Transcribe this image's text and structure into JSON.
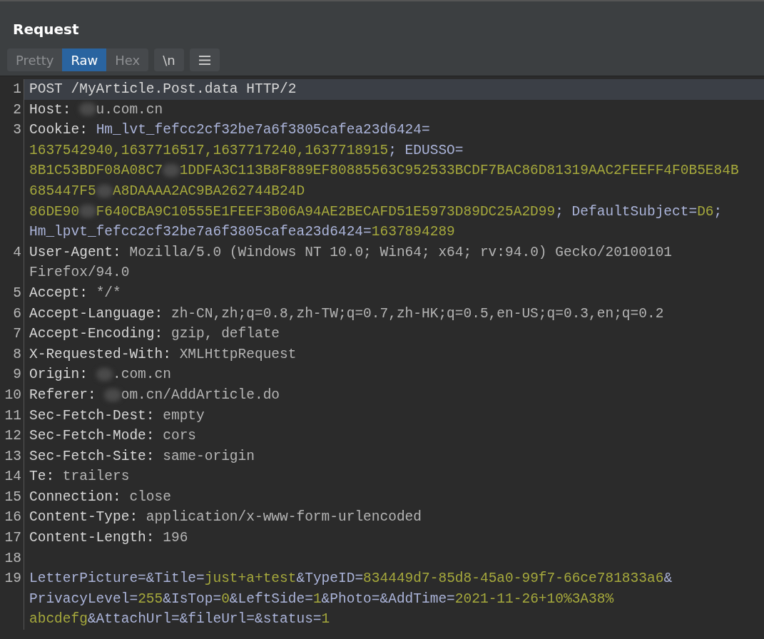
{
  "title": "Request",
  "view_tabs": [
    {
      "label": "Pretty",
      "selected": false
    },
    {
      "label": "Raw",
      "selected": true
    },
    {
      "label": "Hex",
      "selected": false
    }
  ],
  "newline_toggle": {
    "label": "\\n"
  },
  "lines": [
    {
      "number": "1",
      "selected": true,
      "rows": [
        {
          "segments": [
            {
              "kind": "key",
              "text": "POST /MyArticle.Post.data HTTP/2"
            }
          ]
        }
      ]
    },
    {
      "number": "2",
      "selected": false,
      "rows": [
        {
          "segments": [
            {
              "kind": "key",
              "text": "Host: "
            },
            {
              "kind": "redacted"
            },
            {
              "kind": "value",
              "text": "u.com.cn"
            }
          ]
        }
      ]
    },
    {
      "number": "3",
      "selected": false,
      "rows": [
        {
          "segments": [
            {
              "kind": "key",
              "text": "Cookie: "
            },
            {
              "kind": "param",
              "text": "Hm_lvt_fefcc2cf32be7a6f3805cafea23d6424="
            }
          ]
        },
        {
          "segments": [
            {
              "kind": "param_value",
              "text": "1637542940,1637716517,1637717240,1637718915"
            },
            {
              "kind": "param",
              "text": "; EDUSSO="
            }
          ]
        },
        {
          "segments": [
            {
              "kind": "param_value",
              "text": "8B1C53BDF08A08C7"
            },
            {
              "kind": "redacted"
            },
            {
              "kind": "param_value",
              "text": "1DDFA3C113B8F889EF80885563C952533BCDF7BAC86D81319AAC2FEEFF4F0B5E84B"
            }
          ]
        },
        {
          "segments": [
            {
              "kind": "param_value",
              "text": "685447F5"
            },
            {
              "kind": "redacted"
            },
            {
              "kind": "param_value",
              "text": "A8DAAAA2AC9BA262744B24D"
            }
          ]
        },
        {
          "segments": [
            {
              "kind": "param_value",
              "text": "86DE90"
            },
            {
              "kind": "redacted"
            },
            {
              "kind": "param_value",
              "text": "F640CBA9C10555E1FEEF3B06A94AE2BECAFD51E5973D89DC25A2D99"
            },
            {
              "kind": "param",
              "text": "; DefaultSubject="
            },
            {
              "kind": "param_value",
              "text": "D6"
            },
            {
              "kind": "param",
              "text": ";"
            }
          ]
        },
        {
          "segments": [
            {
              "kind": "param",
              "text": "Hm_lpvt_fefcc2cf32be7a6f3805cafea23d6424="
            },
            {
              "kind": "param_value",
              "text": "1637894289"
            }
          ]
        }
      ]
    },
    {
      "number": "4",
      "selected": false,
      "rows": [
        {
          "segments": [
            {
              "kind": "key",
              "text": "User-Agent: "
            },
            {
              "kind": "value",
              "text": "Mozilla/5.0 (Windows NT 10.0; Win64; x64; rv:94.0) Gecko/20100101"
            }
          ]
        },
        {
          "segments": [
            {
              "kind": "value",
              "text": "Firefox/94.0"
            }
          ]
        }
      ]
    },
    {
      "number": "5",
      "selected": false,
      "rows": [
        {
          "segments": [
            {
              "kind": "key",
              "text": "Accept: "
            },
            {
              "kind": "value",
              "text": "*/*"
            }
          ]
        }
      ]
    },
    {
      "number": "6",
      "selected": false,
      "rows": [
        {
          "segments": [
            {
              "kind": "key",
              "text": "Accept-Language: "
            },
            {
              "kind": "value",
              "text": "zh-CN,zh;q=0.8,zh-TW;q=0.7,zh-HK;q=0.5,en-US;q=0.3,en;q=0.2"
            }
          ]
        }
      ]
    },
    {
      "number": "7",
      "selected": false,
      "rows": [
        {
          "segments": [
            {
              "kind": "key",
              "text": "Accept-Encoding: "
            },
            {
              "kind": "value",
              "text": "gzip, deflate"
            }
          ]
        }
      ]
    },
    {
      "number": "8",
      "selected": false,
      "rows": [
        {
          "segments": [
            {
              "kind": "key",
              "text": "X-Requested-With: "
            },
            {
              "kind": "value",
              "text": "XMLHttpRequest"
            }
          ]
        }
      ]
    },
    {
      "number": "9",
      "selected": false,
      "rows": [
        {
          "segments": [
            {
              "kind": "key",
              "text": "Origin: "
            },
            {
              "kind": "redacted"
            },
            {
              "kind": "value",
              "text": ".com.cn"
            }
          ]
        }
      ]
    },
    {
      "number": "10",
      "selected": false,
      "rows": [
        {
          "segments": [
            {
              "kind": "key",
              "text": "Referer: "
            },
            {
              "kind": "redacted"
            },
            {
              "kind": "value",
              "text": "om.cn/AddArticle.do"
            }
          ]
        }
      ]
    },
    {
      "number": "11",
      "selected": false,
      "rows": [
        {
          "segments": [
            {
              "kind": "key",
              "text": "Sec-Fetch-Dest: "
            },
            {
              "kind": "value",
              "text": "empty"
            }
          ]
        }
      ]
    },
    {
      "number": "12",
      "selected": false,
      "rows": [
        {
          "segments": [
            {
              "kind": "key",
              "text": "Sec-Fetch-Mode: "
            },
            {
              "kind": "value",
              "text": "cors"
            }
          ]
        }
      ]
    },
    {
      "number": "13",
      "selected": false,
      "rows": [
        {
          "segments": [
            {
              "kind": "key",
              "text": "Sec-Fetch-Site: "
            },
            {
              "kind": "value",
              "text": "same-origin"
            }
          ]
        }
      ]
    },
    {
      "number": "14",
      "selected": false,
      "rows": [
        {
          "segments": [
            {
              "kind": "key",
              "text": "Te: "
            },
            {
              "kind": "value",
              "text": "trailers"
            }
          ]
        }
      ]
    },
    {
      "number": "15",
      "selected": false,
      "rows": [
        {
          "segments": [
            {
              "kind": "key",
              "text": "Connection: "
            },
            {
              "kind": "value",
              "text": "close"
            }
          ]
        }
      ]
    },
    {
      "number": "16",
      "selected": false,
      "rows": [
        {
          "segments": [
            {
              "kind": "key",
              "text": "Content-Type: "
            },
            {
              "kind": "value",
              "text": "application/x-www-form-urlencoded"
            }
          ]
        }
      ]
    },
    {
      "number": "17",
      "selected": false,
      "rows": [
        {
          "segments": [
            {
              "kind": "key",
              "text": "Content-Length: "
            },
            {
              "kind": "value",
              "text": "196"
            }
          ]
        }
      ]
    },
    {
      "number": "18",
      "selected": false
    },
    {
      "number": "19",
      "selected": false,
      "rows": [
        {
          "segments": [
            {
              "kind": "param",
              "text": "LetterPicture=&Title="
            },
            {
              "kind": "param_value",
              "text": "just+a+test"
            },
            {
              "kind": "param",
              "text": "&TypeID="
            },
            {
              "kind": "param_value",
              "text": "834449d7-85d8-45a0-99f7-66ce781833a6"
            },
            {
              "kind": "param",
              "text": "&"
            }
          ]
        },
        {
          "segments": [
            {
              "kind": "param",
              "text": "PrivacyLevel="
            },
            {
              "kind": "param_value",
              "text": "255"
            },
            {
              "kind": "param",
              "text": "&IsTop="
            },
            {
              "kind": "param_value",
              "text": "0"
            },
            {
              "kind": "param",
              "text": "&LeftSide="
            },
            {
              "kind": "param_value",
              "text": "1"
            },
            {
              "kind": "param",
              "text": "&Photo=&AddTime="
            },
            {
              "kind": "param_value",
              "text": "2021-11-26+10%3A38%"
            }
          ]
        },
        {
          "segments": [
            {
              "kind": "param_value",
              "text": "abcdefg"
            },
            {
              "kind": "param",
              "text": "&AttachUrl=&fileUrl=&status="
            },
            {
              "kind": "param_value",
              "text": "1"
            }
          ]
        }
      ]
    }
  ]
}
